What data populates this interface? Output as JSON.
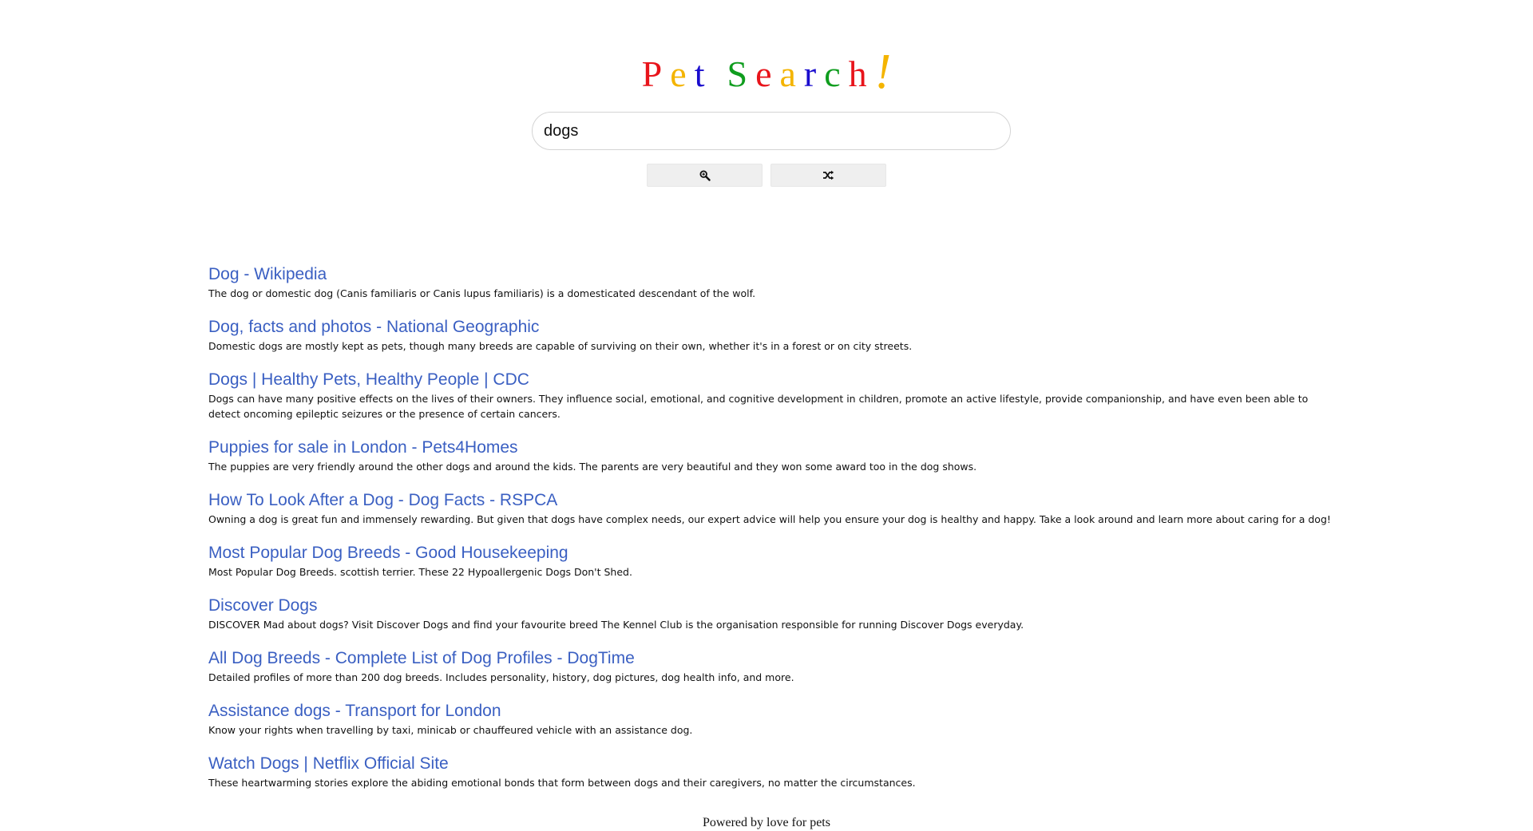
{
  "logo": {
    "letters": [
      {
        "char": "P",
        "color": "#e8141b"
      },
      {
        "char": "e",
        "color": "#f4b400"
      },
      {
        "char": "t",
        "color": "#1a0dce"
      },
      {
        "char": "S",
        "color": "#0f9d1e"
      },
      {
        "char": "e",
        "color": "#e8141b"
      },
      {
        "char": "a",
        "color": "#f4b400"
      },
      {
        "char": "r",
        "color": "#1a0dce"
      },
      {
        "char": "c",
        "color": "#0f9d1e"
      },
      {
        "char": "h",
        "color": "#e8141b"
      },
      {
        "char": "!",
        "color": "#f4b400"
      }
    ]
  },
  "search": {
    "value": "dogs",
    "search_button_icon": "magnifier-icon",
    "random_button_icon": "shuffle-icon"
  },
  "results": [
    {
      "title": "Dog - Wikipedia",
      "description": "The dog or domestic dog (Canis familiaris or Canis lupus familiaris) is a domesticated descendant of the wolf."
    },
    {
      "title": "Dog, facts and photos - National Geographic",
      "description": "Domestic dogs are mostly kept as pets, though many breeds are capable of surviving on their own, whether it's in a forest or on city streets."
    },
    {
      "title": "Dogs | Healthy Pets, Healthy People | CDC",
      "description": "Dogs can have many positive effects on the lives of their owners. They influence social, emotional, and cognitive development in children, promote an active lifestyle, provide companionship, and have even been able to detect oncoming epileptic seizures or the presence of certain cancers."
    },
    {
      "title": "Puppies for sale in London - Pets4Homes",
      "description": "The puppies are very friendly around the other dogs and around the kids. The parents are very beautiful and they won some award too in the dog shows."
    },
    {
      "title": "How To Look After a Dog - Dog Facts - RSPCA",
      "description": "Owning a dog is great fun and immensely rewarding. But given that dogs have complex needs, our expert advice will help you ensure your dog is healthy and happy. Take a look around and learn more about caring for a dog!"
    },
    {
      "title": "Most Popular Dog Breeds - Good Housekeeping",
      "description": "Most Popular Dog Breeds. scottish terrier. These 22 Hypoallergenic Dogs Don't Shed."
    },
    {
      "title": "Discover Dogs",
      "description": "DISCOVER Mad about dogs? Visit Discover Dogs and find your favourite breed The Kennel Club is the organisation responsible for running Discover Dogs everyday."
    },
    {
      "title": "All Dog Breeds - Complete List of Dog Profiles - DogTime",
      "description": "Detailed profiles of more than 200 dog breeds. Includes personality, history, dog pictures, dog health info, and more."
    },
    {
      "title": "Assistance dogs - Transport for London",
      "description": "Know your rights when travelling by taxi, minicab or chauffeured vehicle with an assistance dog."
    },
    {
      "title": "Watch Dogs | Netflix Official Site",
      "description": "These heartwarming stories explore the abiding emotional bonds that form between dogs and their caregivers, no matter the circumstances."
    }
  ],
  "footer": {
    "text": "Powered by love for pets"
  }
}
